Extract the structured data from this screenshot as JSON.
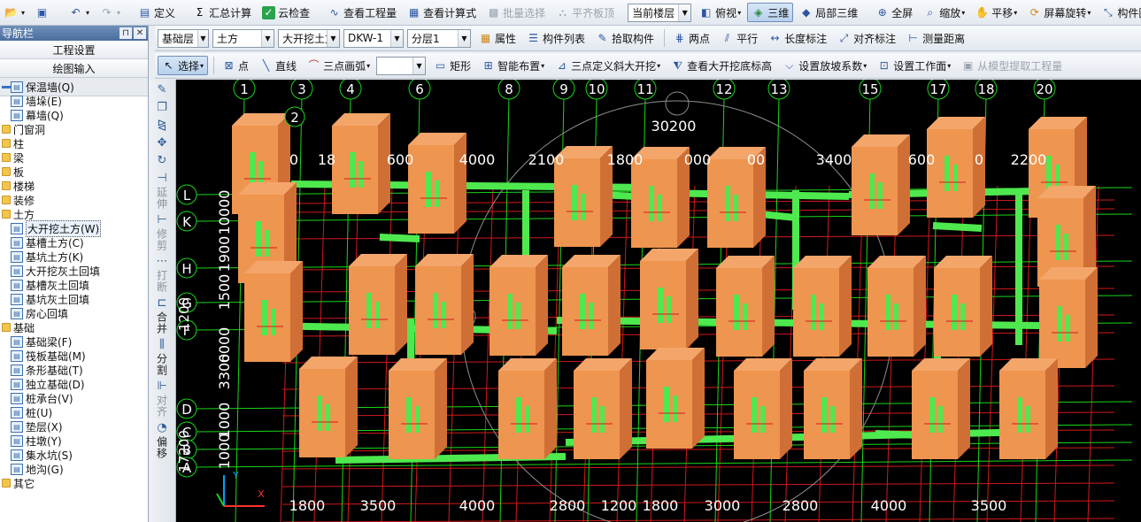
{
  "colors": {
    "earth": "#ee9550",
    "earth_shade": "#d06f35",
    "earth_top": "#f4a56a",
    "beam": "#4ee94e",
    "grid_red": "#d11a1a",
    "axis_green": "#19d619",
    "canvas_bg": "#000000",
    "text_white": "#ffffff"
  },
  "toolbar1": {
    "items": [
      {
        "icon": "open-folder-icon",
        "label": ""
      },
      {
        "icon": "save-icon",
        "label": ""
      },
      {
        "icon": "undo-icon",
        "label": ""
      },
      {
        "icon": "redo-icon",
        "label": ""
      },
      {
        "icon": "define-icon",
        "label": "定义"
      },
      {
        "icon": "sum-icon",
        "label": "汇总计算"
      },
      {
        "icon": "cloud-check-icon",
        "label": "云检查"
      },
      {
        "icon": "view-quantity-icon",
        "label": "查看工程量"
      },
      {
        "icon": "view-formula-icon",
        "label": "查看计算式"
      },
      {
        "icon": "batch-select-icon",
        "label": "批量选择"
      },
      {
        "icon": "align-slab-top-icon",
        "label": "平齐板顶"
      }
    ],
    "floor_select": "当前楼层",
    "view_items": [
      {
        "icon": "top-view-icon",
        "label": "俯视"
      },
      {
        "icon": "3d-icon",
        "label": "三维"
      },
      {
        "icon": "local-3d-icon",
        "label": "局部三维"
      },
      {
        "icon": "fullscreen-icon",
        "label": "全屏"
      },
      {
        "icon": "zoom-icon",
        "label": "缩放"
      },
      {
        "icon": "pan-icon",
        "label": "平移"
      },
      {
        "icon": "rotate-screen-icon",
        "label": "屏幕旋转"
      },
      {
        "icon": "element-display-icon",
        "label": "构件图元显示"
      }
    ]
  },
  "nav": {
    "title": "导航栏",
    "btn_project": "工程设置",
    "btn_draw": "绘图输入",
    "tree": [
      {
        "type": "leaf",
        "indent": 1,
        "label": "保温墙(Q)"
      },
      {
        "type": "leaf",
        "indent": 1,
        "label": "墙垛(E)"
      },
      {
        "type": "leaf",
        "indent": 1,
        "label": "幕墙(Q)"
      },
      {
        "type": "folder",
        "indent": 0,
        "label": "门窗洞"
      },
      {
        "type": "folder",
        "indent": 0,
        "label": "柱"
      },
      {
        "type": "folder",
        "indent": 0,
        "label": "梁"
      },
      {
        "type": "folder",
        "indent": 0,
        "label": "板"
      },
      {
        "type": "folder",
        "indent": 0,
        "label": "楼梯"
      },
      {
        "type": "folder",
        "indent": 0,
        "label": "装修"
      },
      {
        "type": "folder",
        "indent": 0,
        "label": "土方"
      },
      {
        "type": "leaf",
        "indent": 1,
        "label": "大开挖土方(W)",
        "selected": true
      },
      {
        "type": "leaf",
        "indent": 1,
        "label": "基槽土方(C)"
      },
      {
        "type": "leaf",
        "indent": 1,
        "label": "基坑土方(K)"
      },
      {
        "type": "leaf",
        "indent": 1,
        "label": "大开挖灰土回填"
      },
      {
        "type": "leaf",
        "indent": 1,
        "label": "基槽灰土回填"
      },
      {
        "type": "leaf",
        "indent": 1,
        "label": "基坑灰土回填"
      },
      {
        "type": "leaf",
        "indent": 1,
        "label": "房心回填"
      },
      {
        "type": "folder",
        "indent": 0,
        "label": "基础"
      },
      {
        "type": "leaf",
        "indent": 1,
        "label": "基础梁(F)"
      },
      {
        "type": "leaf",
        "indent": 1,
        "label": "筏板基础(M)"
      },
      {
        "type": "leaf",
        "indent": 1,
        "label": "条形基础(T)"
      },
      {
        "type": "leaf",
        "indent": 1,
        "label": "独立基础(D)"
      },
      {
        "type": "leaf",
        "indent": 1,
        "label": "桩承台(V)"
      },
      {
        "type": "leaf",
        "indent": 1,
        "label": "桩(U)"
      },
      {
        "type": "leaf",
        "indent": 1,
        "label": "垫层(X)"
      },
      {
        "type": "leaf",
        "indent": 1,
        "label": "柱墩(Y)"
      },
      {
        "type": "leaf",
        "indent": 1,
        "label": "集水坑(S)"
      },
      {
        "type": "leaf",
        "indent": 1,
        "label": "地沟(G)"
      },
      {
        "type": "folder",
        "indent": 0,
        "label": "其它"
      }
    ]
  },
  "toolbar2": {
    "layer": "基础层",
    "category": "土方",
    "type": "大开挖土方",
    "element": "DKW-1",
    "sublayer": "分层1",
    "items": [
      {
        "icon": "properties-icon",
        "label": "属性"
      },
      {
        "icon": "element-list-icon",
        "label": "构件列表"
      },
      {
        "icon": "pick-element-icon",
        "label": "拾取构件"
      },
      {
        "icon": "two-points-icon",
        "label": "两点"
      },
      {
        "icon": "parallel-icon",
        "label": "平行"
      },
      {
        "icon": "length-dimension-icon",
        "label": "长度标注"
      },
      {
        "icon": "aligned-dimension-icon",
        "label": "对齐标注"
      },
      {
        "icon": "measure-distance-icon",
        "label": "测量距离"
      }
    ]
  },
  "toolbar3": {
    "select": "选择",
    "point": "点",
    "line": "直线",
    "arc": "三点画弧",
    "arc_value": "",
    "rect": "矩形",
    "smart": "智能布置",
    "slope": "三点定义斜大开挖",
    "bottom_elev": "查看大开挖底标高",
    "slope_coef": "设置放坡系数",
    "work_face": "设置工作面",
    "extract": "从模型提取工程量"
  },
  "vbar": [
    "延伸",
    "修剪",
    "打断",
    "合并",
    "分割",
    "对齐",
    "偏移"
  ],
  "axes_top": [
    "1",
    "3",
    "4",
    "6",
    "8",
    "9",
    "10",
    "11",
    "12",
    "13",
    "15",
    "17",
    "18",
    "20"
  ],
  "axes_left": [
    "L",
    "K",
    "H",
    "G",
    "F",
    "D",
    "C",
    "B",
    "A"
  ],
  "dims_top": [
    "30200",
    "0",
    "18",
    "600",
    "4000",
    "2100",
    "1800",
    "000",
    "00",
    "3400",
    "600",
    "0",
    "2200"
  ],
  "dims_bottom": [
    "1800",
    "3500",
    "4000",
    "2800",
    "1200",
    "1800",
    "3000",
    "2800",
    "4000",
    "3500"
  ],
  "dims_left": [
    "10000",
    "1900",
    "1500",
    "6000",
    "3300",
    "1000",
    "1000"
  ],
  "dims_left_outer": [
    "1200",
    "17200"
  ],
  "axis_marker2": "2",
  "coord": {
    "x": "X",
    "y": "Y"
  }
}
